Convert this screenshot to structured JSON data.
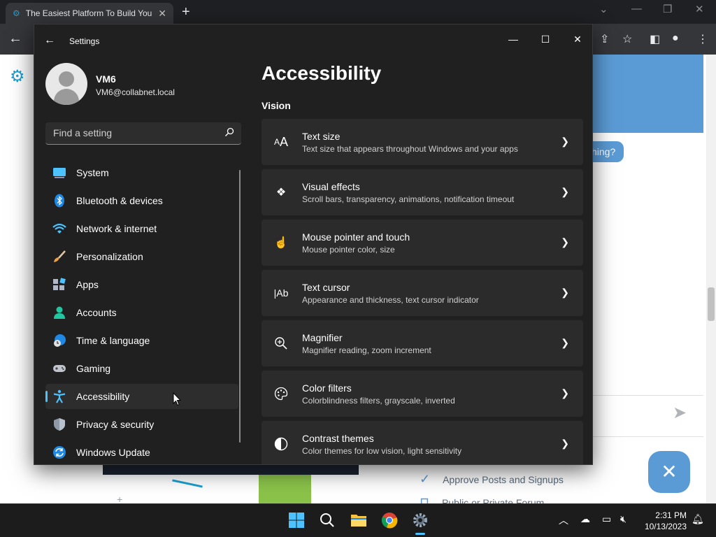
{
  "browser": {
    "tab_title": "The Easiest Platform To Build You",
    "tab_close": "✕",
    "new_tab": "+",
    "page_bubble": "hing?",
    "features": [
      "Approve Posts and Signups",
      "Public or Private Forum"
    ]
  },
  "settings": {
    "window_title": "Settings",
    "user": {
      "name": "VM6",
      "email": "VM6@collabnet.local"
    },
    "search": {
      "placeholder": "Find a setting"
    },
    "nav": [
      {
        "label": "System",
        "icon": "system-icon"
      },
      {
        "label": "Bluetooth & devices",
        "icon": "bluetooth-icon"
      },
      {
        "label": "Network & internet",
        "icon": "wifi-icon"
      },
      {
        "label": "Personalization",
        "icon": "brush-icon"
      },
      {
        "label": "Apps",
        "icon": "apps-icon"
      },
      {
        "label": "Accounts",
        "icon": "person-icon"
      },
      {
        "label": "Time & language",
        "icon": "globe-clock-icon"
      },
      {
        "label": "Gaming",
        "icon": "gamepad-icon"
      },
      {
        "label": "Accessibility",
        "icon": "accessibility-icon",
        "selected": true
      },
      {
        "label": "Privacy & security",
        "icon": "shield-icon"
      },
      {
        "label": "Windows Update",
        "icon": "update-icon"
      }
    ],
    "page_title": "Accessibility",
    "section": "Vision",
    "cards": [
      {
        "title": "Text size",
        "desc": "Text size that appears throughout Windows and your apps",
        "icon": "text-size-icon"
      },
      {
        "title": "Visual effects",
        "desc": "Scroll bars, transparency, animations, notification timeout",
        "icon": "sparkle-icon"
      },
      {
        "title": "Mouse pointer and touch",
        "desc": "Mouse pointer color, size",
        "icon": "pointer-touch-icon"
      },
      {
        "title": "Text cursor",
        "desc": "Appearance and thickness, text cursor indicator",
        "icon": "text-cursor-icon"
      },
      {
        "title": "Magnifier",
        "desc": "Magnifier reading, zoom increment",
        "icon": "magnifier-icon"
      },
      {
        "title": "Color filters",
        "desc": "Colorblindness filters, grayscale, inverted",
        "icon": "palette-icon"
      },
      {
        "title": "Contrast themes",
        "desc": "Color themes for low vision, light sensitivity",
        "icon": "contrast-icon"
      }
    ]
  },
  "taskbar": {
    "time": "2:31 PM",
    "date": "10/13/2023"
  },
  "colors": {
    "accent": "#4cc2ff",
    "window_bg": "#202020",
    "card_bg": "#2b2b2b"
  }
}
